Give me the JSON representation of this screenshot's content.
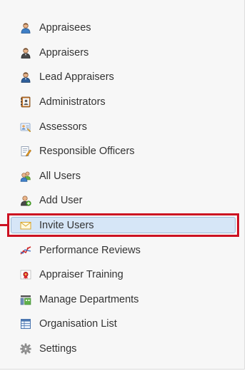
{
  "menu": {
    "items": [
      {
        "label": "Appraisees",
        "icon": "user-icon"
      },
      {
        "label": "Appraisers",
        "icon": "user-dark-icon"
      },
      {
        "label": "Lead Appraisers",
        "icon": "user-dark-icon"
      },
      {
        "label": "Administrators",
        "icon": "address-book-icon"
      },
      {
        "label": "Assessors",
        "icon": "user-card-icon"
      },
      {
        "label": "Responsible Officers",
        "icon": "edit-document-icon"
      },
      {
        "label": "All Users",
        "icon": "users-icon"
      },
      {
        "label": "Add User",
        "icon": "user-add-icon"
      },
      {
        "label": "Invite Users",
        "icon": "envelope-icon"
      },
      {
        "label": "Performance Reviews",
        "icon": "chart-line-icon"
      },
      {
        "label": "Appraiser Training",
        "icon": "certificate-icon"
      },
      {
        "label": "Manage Departments",
        "icon": "departments-icon"
      },
      {
        "label": "Organisation List",
        "icon": "table-icon"
      },
      {
        "label": "Settings",
        "icon": "gear-icon"
      }
    ],
    "selected_index": 8
  },
  "colors": {
    "highlight_border": "#cc1122",
    "selected_background": "#d6e6f7"
  }
}
